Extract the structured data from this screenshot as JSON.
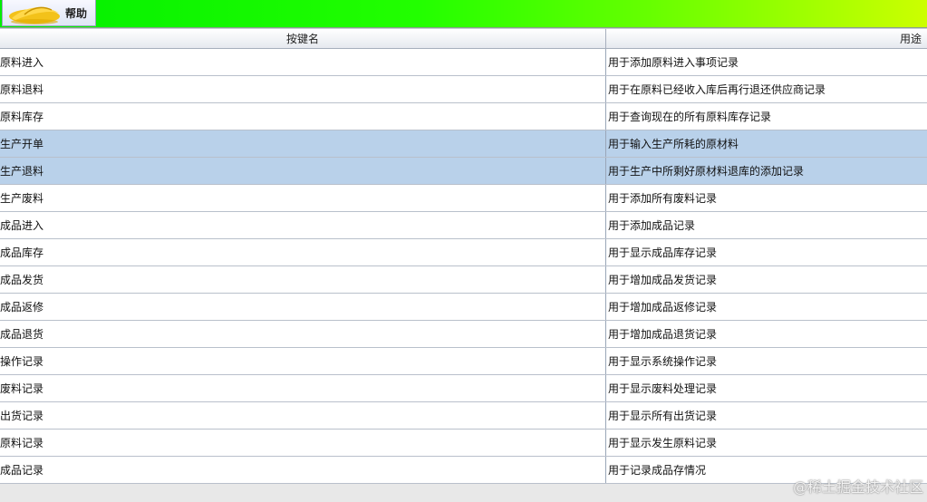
{
  "tab": {
    "label": "帮助",
    "icon": "fruit-logo-icon"
  },
  "table": {
    "columns": [
      "按键名",
      "用途"
    ],
    "rows": [
      {
        "name": "原料进入",
        "use": "用于添加原料进入事项记录"
      },
      {
        "name": "原料退料",
        "use": "用于在原料已经收入库后再行退还供应商记录"
      },
      {
        "name": "原料库存",
        "use": "用于查询现在的所有原料库存记录"
      },
      {
        "name": "生产开单",
        "use": "用于输入生产所耗的原材料"
      },
      {
        "name": "生产退料",
        "use": "用于生产中所剩好原材料退库的添加记录"
      },
      {
        "name": "生产废料",
        "use": "用于添加所有废料记录"
      },
      {
        "name": "成品进入",
        "use": "用于添加成品记录"
      },
      {
        "name": "成品库存",
        "use": "用于显示成品库存记录"
      },
      {
        "name": "成品发货",
        "use": "用于增加成品发货记录"
      },
      {
        "name": "成品返修",
        "use": "用于增加成品返修记录"
      },
      {
        "name": "成品退货",
        "use": "用于增加成品退货记录"
      },
      {
        "name": "操作记录",
        "use": "用于显示系统操作记录"
      },
      {
        "name": "废料记录",
        "use": "用于显示废料处理记录"
      },
      {
        "name": "出货记录",
        "use": "用于显示所有出货记录"
      },
      {
        "name": "原料记录",
        "use": "用于显示发生原料记录"
      },
      {
        "name": "成品记录",
        "use": "用于记录成品存情况"
      }
    ]
  },
  "watermark": "@稀土掘金技术社区",
  "colors": {
    "selected_row": "#b9d1ea",
    "topbar_start": "#00ee00",
    "topbar_end": "#ccff00"
  }
}
